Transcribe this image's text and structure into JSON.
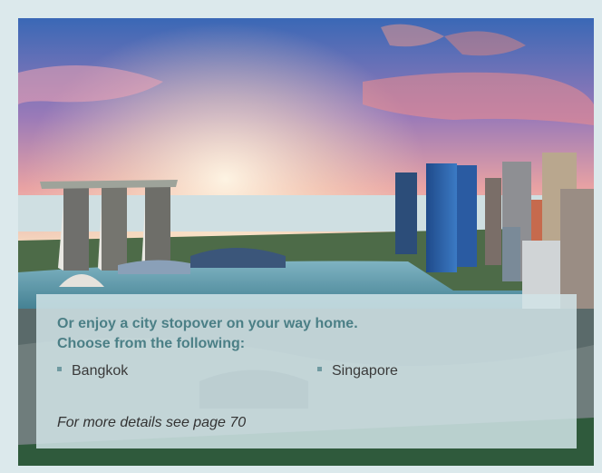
{
  "panel": {
    "heading_line1": "Or enjoy a city stopover on your way home.",
    "heading_line2": "Choose from the following:",
    "cities": [
      "Bangkok",
      "Singapore"
    ],
    "note": "For more details see page 70"
  },
  "photo": {
    "subject": "city skyline at sunset",
    "icon": "photo-image"
  },
  "colors": {
    "page_background": "#dce9ec",
    "heading": "#4b7f86",
    "bullet": "#6f9aa1",
    "panel_overlay": "#d0e3e7"
  }
}
